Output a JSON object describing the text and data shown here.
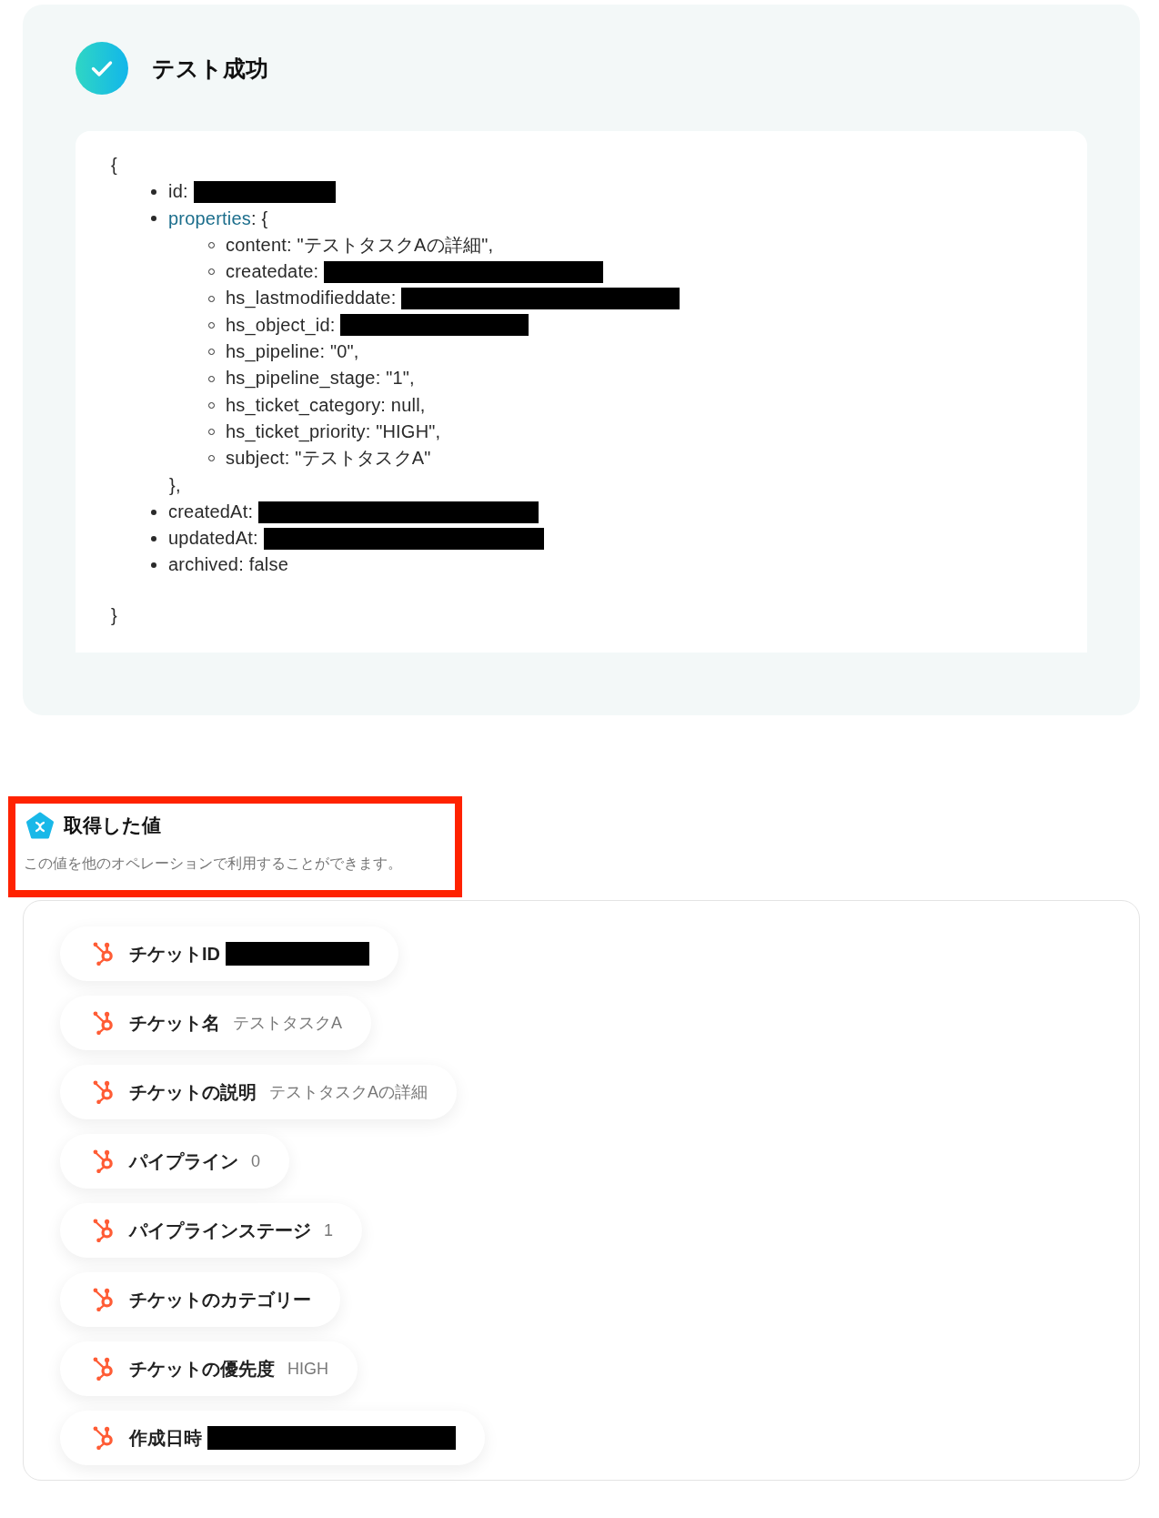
{
  "test_result": {
    "title": "テスト成功",
    "response": {
      "open_brace": "{",
      "fields": [
        {
          "text": "id:",
          "redacted": true
        },
        {
          "key": "properties",
          "text": ": {",
          "redacted": false,
          "children": [
            {
              "text": "content: \"テストタスクAの詳細\",",
              "redacted": false
            },
            {
              "text": "createdate:",
              "redacted": true
            },
            {
              "text": "hs_lastmodifieddate:",
              "redacted": true
            },
            {
              "text": "hs_object_id:",
              "redacted": true
            },
            {
              "text": "hs_pipeline: \"0\",",
              "redacted": false
            },
            {
              "text": "hs_pipeline_stage: \"1\",",
              "redacted": false
            },
            {
              "text": "hs_ticket_category: null,",
              "redacted": false
            },
            {
              "text": "hs_ticket_priority: \"HIGH\",",
              "redacted": false
            },
            {
              "text": "subject: \"テストタスクA\"",
              "redacted": false
            }
          ],
          "close": "},"
        },
        {
          "text": "createdAt:",
          "redacted": true
        },
        {
          "text": "updatedAt:",
          "redacted": true
        },
        {
          "text": "archived: false",
          "redacted": false
        }
      ],
      "close_brace": "}"
    }
  },
  "retrieved_values": {
    "highlighted": true,
    "title": "取得した値",
    "description": "この値を他のオペレーションで利用することができます。",
    "items": [
      {
        "label": "チケットID",
        "redacted": true
      },
      {
        "label": "チケット名",
        "value": "テストタスクA",
        "redacted": false
      },
      {
        "label": "チケットの説明",
        "value": "テストタスクAの詳細",
        "redacted": false
      },
      {
        "label": "パイプライン",
        "value": "0",
        "redacted": false
      },
      {
        "label": "パイプラインステージ",
        "value": "1",
        "redacted": false
      },
      {
        "label": "チケットのカテゴリー",
        "redacted": false
      },
      {
        "label": "チケットの優先度",
        "value": "HIGH",
        "redacted": false
      },
      {
        "label": "作成日時",
        "redacted": true
      }
    ]
  }
}
